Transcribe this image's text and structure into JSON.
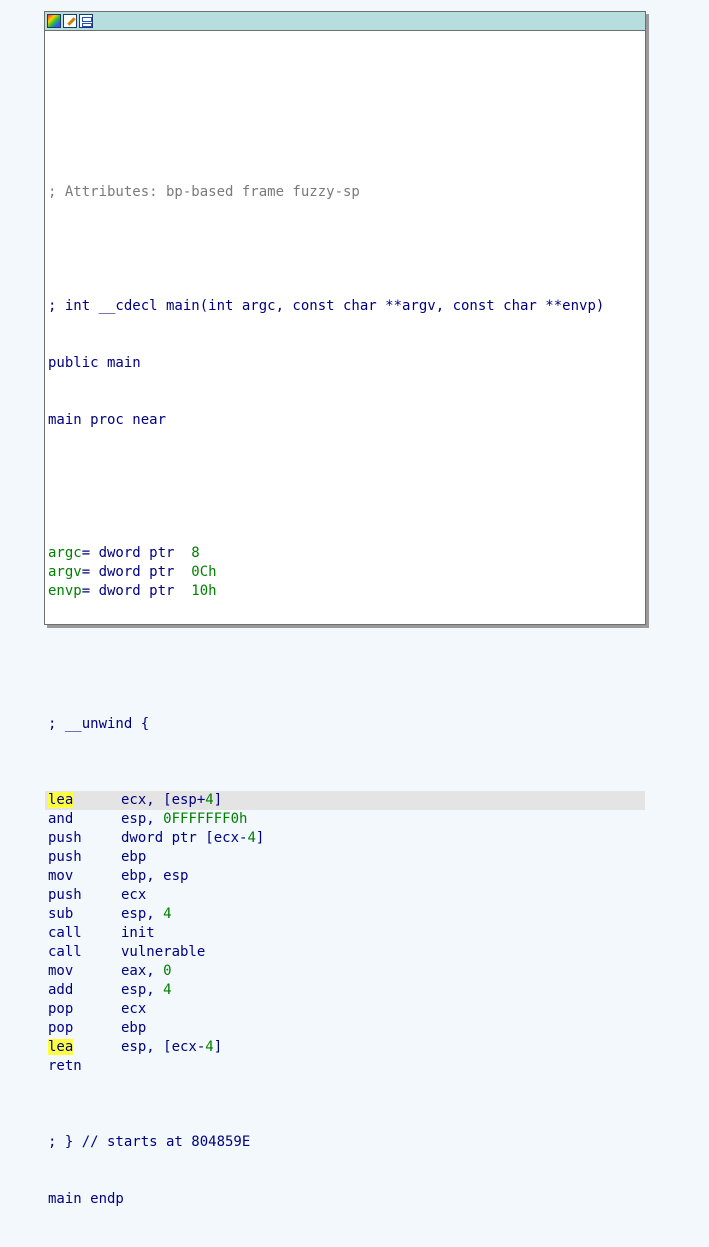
{
  "titlebar": {
    "icons": [
      "color-palette-icon",
      "edit-pencil-icon",
      "graph-overview-icon"
    ]
  },
  "header": {
    "attributes_comment": "; Attributes: bp-based frame fuzzy-sp",
    "signature_comment": "; int __cdecl main(int argc, const char **argv, const char **envp)",
    "public_line": "public main",
    "proc_line": "main proc near"
  },
  "vars": [
    {
      "name": "argc",
      "decl": "= dword ptr  ",
      "offset": "8"
    },
    {
      "name": "argv",
      "decl": "= dword ptr  ",
      "offset": "0Ch"
    },
    {
      "name": "envp",
      "decl": "= dword ptr  ",
      "offset": "10h"
    }
  ],
  "unwind_comment": "; __unwind {",
  "instructions": [
    {
      "mnemonic": "lea",
      "op1": "ecx, [esp+",
      "num": "4",
      "op2": "]"
    },
    {
      "mnemonic": "and",
      "op1": "esp, ",
      "num": "0FFFFFFF0h",
      "op2": ""
    },
    {
      "mnemonic": "push",
      "op1": "dword ptr [ecx-",
      "num": "4",
      "op2": "]"
    },
    {
      "mnemonic": "push",
      "op1": "ebp",
      "num": "",
      "op2": ""
    },
    {
      "mnemonic": "mov",
      "op1": "ebp, esp",
      "num": "",
      "op2": ""
    },
    {
      "mnemonic": "push",
      "op1": "ecx",
      "num": "",
      "op2": ""
    },
    {
      "mnemonic": "sub",
      "op1": "esp, ",
      "num": "4",
      "op2": ""
    },
    {
      "mnemonic": "call",
      "op1": "init",
      "num": "",
      "op2": ""
    },
    {
      "mnemonic": "call",
      "op1": "vulnerable",
      "num": "",
      "op2": ""
    },
    {
      "mnemonic": "mov",
      "op1": "eax, ",
      "num": "0",
      "op2": ""
    },
    {
      "mnemonic": "add",
      "op1": "esp, ",
      "num": "4",
      "op2": ""
    },
    {
      "mnemonic": "pop",
      "op1": "ecx",
      "num": "",
      "op2": ""
    },
    {
      "mnemonic": "pop",
      "op1": "ebp",
      "num": "",
      "op2": ""
    },
    {
      "mnemonic": "lea",
      "op1": "esp, [ecx-",
      "num": "4",
      "op2": "]"
    },
    {
      "mnemonic": "retn",
      "op1": "",
      "num": "",
      "op2": ""
    }
  ],
  "footer": {
    "end_comment": "; } // starts at 804859E",
    "endp_line": "main endp"
  },
  "colors": {
    "titlebar": "#b6dede",
    "code_text": "#000080",
    "comment": "#7a7a7a",
    "number": "#008000",
    "selected_line": "#e4e4e4",
    "search_highlight": "#ffff40"
  }
}
